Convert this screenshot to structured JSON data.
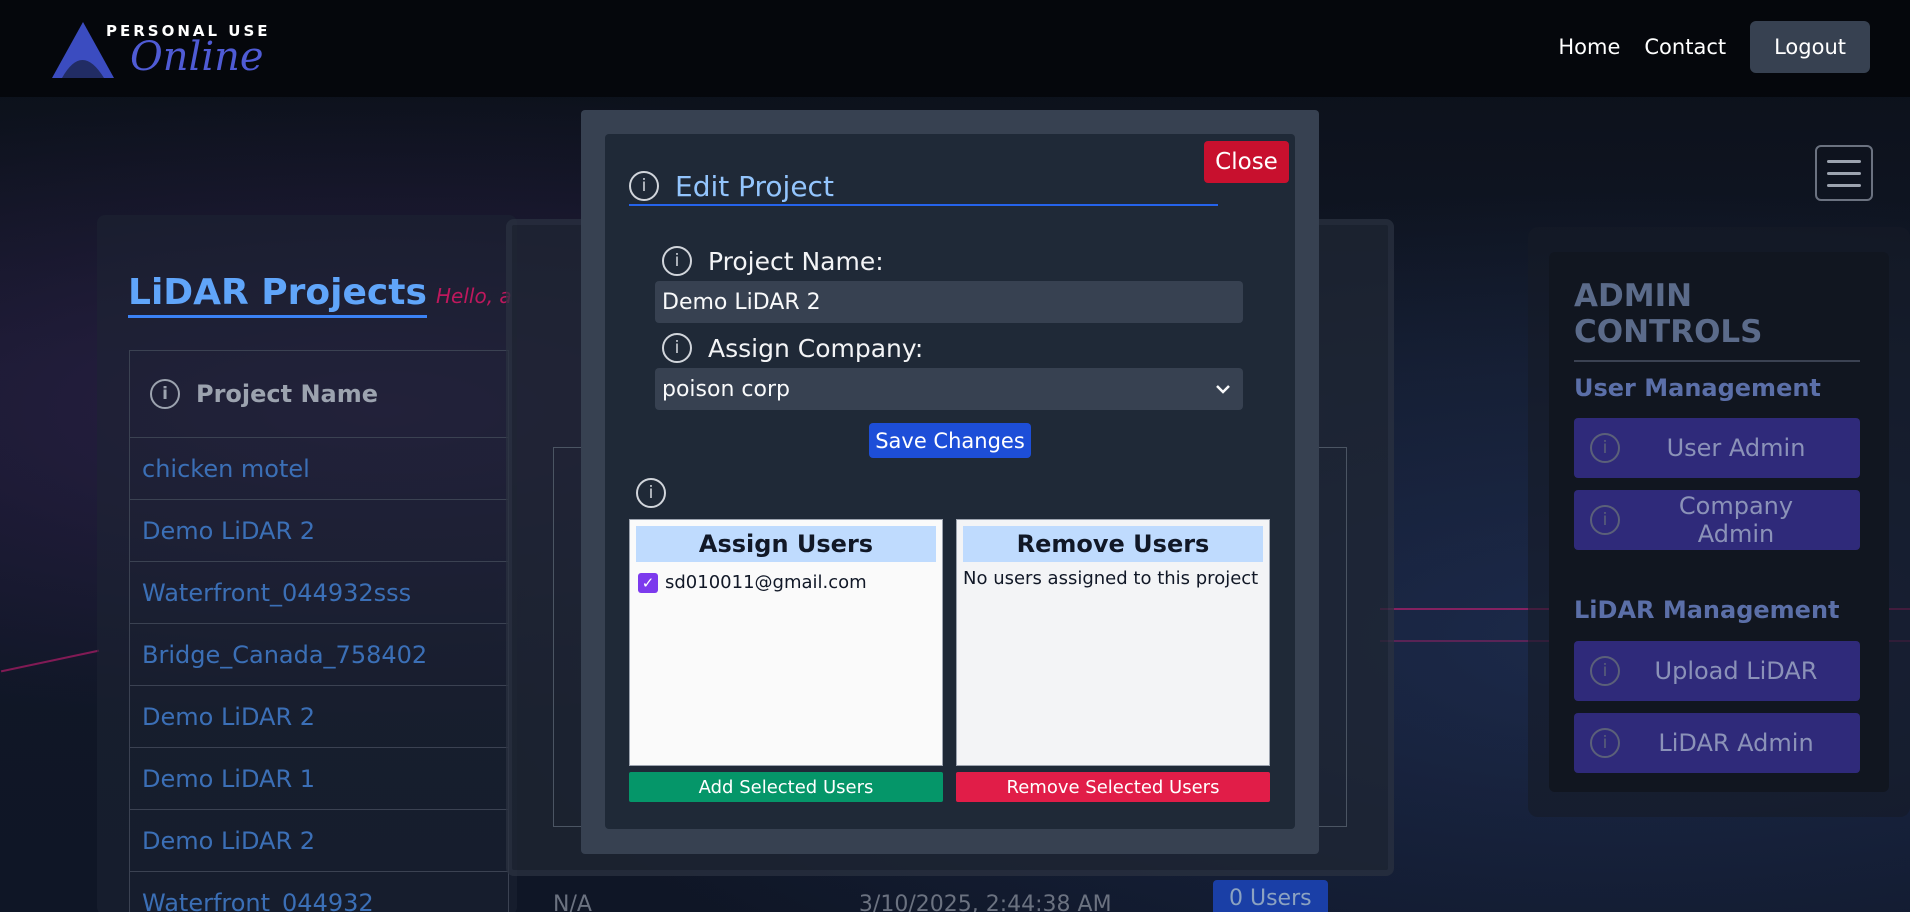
{
  "header": {
    "logo_top": "PERSONAL USE",
    "logo_bottom": "Online",
    "nav": {
      "home": "Home",
      "contact": "Contact",
      "logout": "Logout"
    }
  },
  "projects": {
    "title": "LiDAR Projects",
    "greeting": "Hello, a",
    "column_header": "Project Name",
    "rows": [
      "chicken motel",
      "Demo LiDAR 2",
      "Waterfront_044932sss",
      "Bridge_Canada_758402",
      "Demo LiDAR 2",
      "Demo LiDAR 1",
      "Demo LiDAR 2",
      "Waterfront_044932"
    ]
  },
  "background_table": {
    "partial_row": "N/A",
    "partial_date": "3/10/2025, 2:44:38 AM",
    "partial_badge": "0 Users"
  },
  "admin": {
    "title": "ADMIN CONTROLS",
    "user_section": "User Management",
    "user_admin": "User Admin",
    "company_admin": "Company Admin",
    "lidar_section": "LiDAR Management",
    "upload_lidar": "Upload LiDAR",
    "lidar_admin": "LiDAR Admin"
  },
  "modal": {
    "title": "Edit Project",
    "close_label": "Close",
    "project_name_label": "Project Name:",
    "project_name_value": "Demo LiDAR 2",
    "assign_company_label": "Assign Company:",
    "assign_company_value": "poison corp",
    "save_label": "Save Changes",
    "assign_users_title": "Assign Users",
    "assign_users": [
      "sd010011@gmail.com"
    ],
    "remove_users_title": "Remove Users",
    "remove_users_empty": "No users assigned to this project",
    "add_selected_label": "Add Selected Users",
    "remove_selected_label": "Remove Selected Users"
  },
  "icons": {
    "info": "info-icon",
    "menu": "hamburger-icon",
    "dropdown": "chevron-down-icon",
    "check": "checkmark-icon"
  },
  "colors": {
    "close": "#c8102e",
    "save": "#1d4ed8",
    "add": "#059669",
    "remove": "#e11d48",
    "admin_button": "#2f2a7a"
  }
}
